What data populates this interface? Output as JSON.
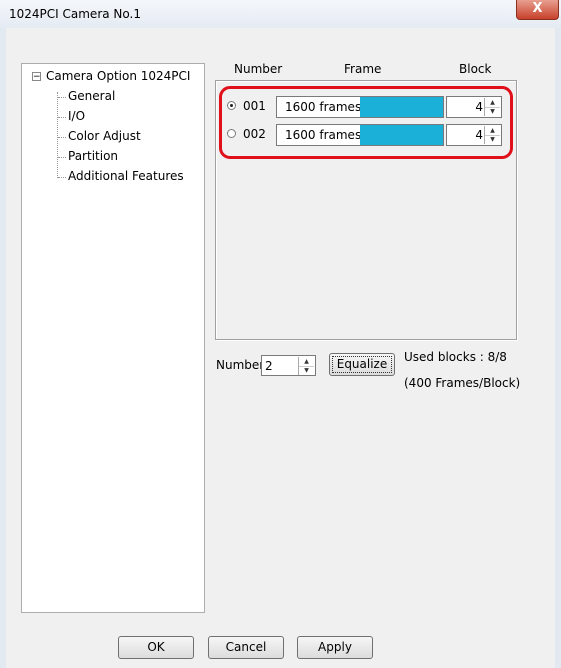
{
  "window": {
    "title": "1024PCI  Camera No.1",
    "close_glyph": "X"
  },
  "tree": {
    "expander_glyph": "−",
    "root_label": "Camera Option 1024PCI",
    "items": [
      "General",
      "I/O",
      "Color Adjust",
      "Partition",
      "Additional Features"
    ]
  },
  "partition": {
    "headers": {
      "number": "Number",
      "frame": "Frame",
      "block": "Block"
    },
    "rows": [
      {
        "number": "001",
        "selected": true,
        "frames": "1600 frames",
        "fill_fraction": 0.5,
        "block": "4"
      },
      {
        "number": "002",
        "selected": false,
        "frames": "1600 frames",
        "fill_fraction": 0.5,
        "block": "4"
      }
    ],
    "highlight_color": "#e0101a",
    "fill_color": "#1ab0d8"
  },
  "controls": {
    "number_label": "Number",
    "number_value": "2",
    "equalize_label": "Equalize",
    "used_blocks": "Used blocks : 8/8",
    "frames_per_block": "(400 Frames/Block)"
  },
  "buttons": {
    "ok": "OK",
    "cancel": "Cancel",
    "apply": "Apply"
  },
  "spinner_glyphs": {
    "up": "▲",
    "down": "▼"
  }
}
